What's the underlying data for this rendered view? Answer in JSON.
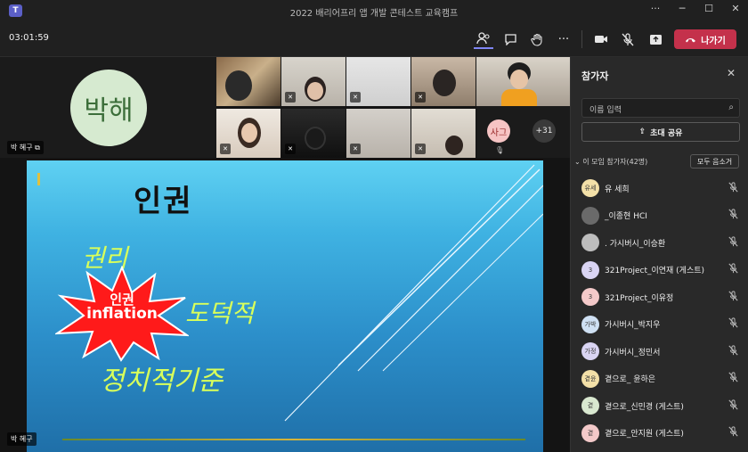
{
  "window": {
    "title": "2022 배리어프리 앱 개발 콘테스트 교육캠프",
    "logo_label": "T",
    "controls": [
      "···",
      "─",
      "☐",
      "✕"
    ]
  },
  "toolbar": {
    "timer": "03:01:59",
    "icons": {
      "people": "👥",
      "chat": "💬",
      "react": "✋",
      "more": "···",
      "camera": "🎥",
      "mic": "🎙",
      "share": "⬆"
    },
    "leave_label": "나가기",
    "leave_color": "#c4314b"
  },
  "stage": {
    "self_initials": "박해",
    "self_name": "박 혜구",
    "overflow_initials": "사그",
    "overflow_count": "+31",
    "presenter_name": "박 혜구"
  },
  "slide": {
    "title": "인권",
    "words": {
      "w1": "권리",
      "w2": "도덕적",
      "w3": "정치적기준"
    },
    "burst_line1": "인권",
    "burst_line2": "inflation"
  },
  "panel": {
    "title": "참가자",
    "search_placeholder": "이름 입력",
    "share_label": "초대 공유",
    "section_label": "이 모임 참가자(42명)",
    "mute_all_label": "모두 음소거",
    "participants": [
      {
        "initials": "유세",
        "name": "유 세희",
        "color": "#f3e0a8"
      },
      {
        "initials": "",
        "name": "_이종현 HCI",
        "color": "#6a6a6a"
      },
      {
        "initials": "",
        "name": ". 가시버시_이승환",
        "color": "#bdbdbd"
      },
      {
        "initials": "3",
        "name": "321Project_이연재 (게스트)",
        "color": "#d9d4f3"
      },
      {
        "initials": "3",
        "name": "321Project_이유정",
        "color": "#f3c9c9"
      },
      {
        "initials": "가박",
        "name": "가시버시_박지우",
        "color": "#cfe0f3"
      },
      {
        "initials": "가정",
        "name": "가시버시_정민서",
        "color": "#d9d4f3"
      },
      {
        "initials": "곁윤",
        "name": "곁으로_ 윤하은",
        "color": "#f3e0a8"
      },
      {
        "initials": "곁",
        "name": "곁으로_신민경 (게스트)",
        "color": "#d9e8d0"
      },
      {
        "initials": "곁",
        "name": "곁으로_안지원 (게스트)",
        "color": "#f3c9c9"
      }
    ]
  }
}
